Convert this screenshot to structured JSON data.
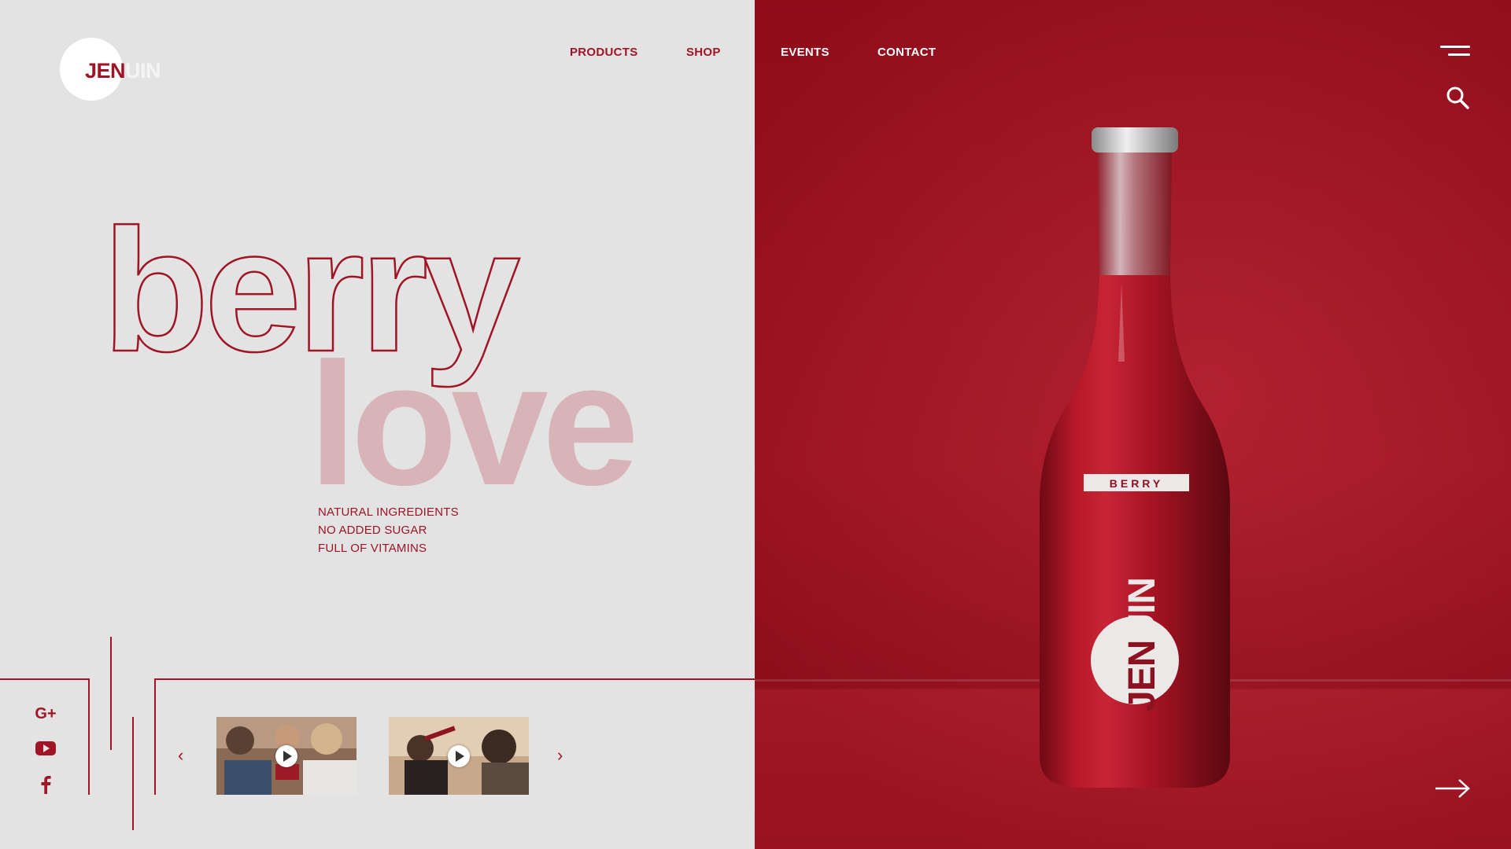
{
  "brand": {
    "logo_part1": "JEN",
    "logo_part2": "UIN",
    "colors": {
      "primary": "#a01525",
      "background": "#e3e3e4",
      "hero_panel": "#a81324",
      "love_text": "#d8b3b8"
    }
  },
  "nav": {
    "products": "PRODUCTS",
    "shop": "SHOP",
    "events": "EVENTS",
    "contact": "CONTACT"
  },
  "header_icons": {
    "menu": "hamburger-menu-icon",
    "search": "search-icon"
  },
  "hero": {
    "headline_outline": "berry",
    "headline_filled": "love",
    "features": [
      "NATURAL INGREDIENTS",
      "NO ADDED SUGAR",
      "FULL OF VITAMINS"
    ]
  },
  "social": [
    "google-plus-icon",
    "youtube-icon",
    "facebook-icon"
  ],
  "social_labels": {
    "google_plus": "G+"
  },
  "video_carousel": {
    "prev_icon": "‹",
    "next_icon": "›",
    "videos": [
      {
        "name": "friends-toasting-video"
      },
      {
        "name": "woman-drinking-video"
      }
    ]
  },
  "product": {
    "flavor_label": "BERRY",
    "bottle_brand_part1": "JEN",
    "bottle_brand_part2": "UIN"
  },
  "next_icon": "arrow-right-icon"
}
